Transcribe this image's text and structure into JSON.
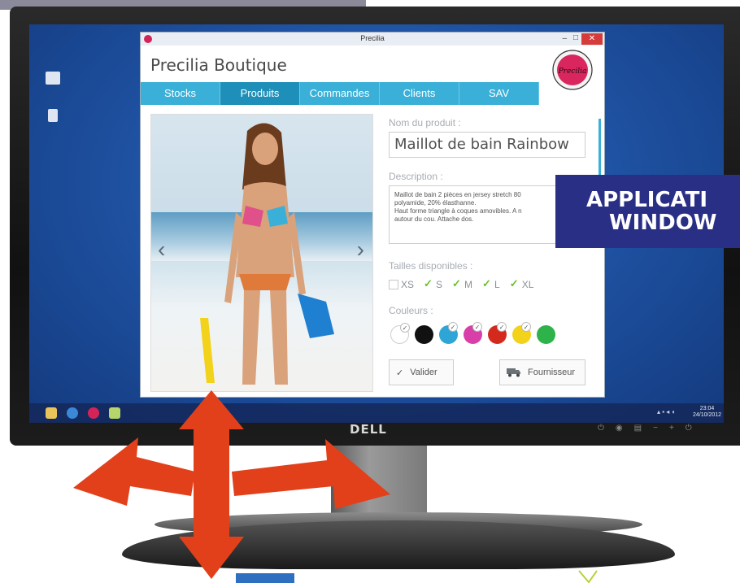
{
  "app": {
    "window_title": "Precilia",
    "app_name": "Precilia Boutique",
    "logo_text": "Precilia"
  },
  "nav": {
    "tabs": [
      {
        "label": "Stocks"
      },
      {
        "label": "Produits",
        "active": true
      },
      {
        "label": "Commandes"
      },
      {
        "label": "Clients"
      },
      {
        "label": "SAV"
      }
    ]
  },
  "product": {
    "name_label": "Nom du produit :",
    "name_value": "Maillot de bain Rainbow",
    "description_label": "Description :",
    "description_value": "Maillot de bain 2 pièces en jersey stretch 80\npolyamide, 20% élasthanne.\nHaut forme triangle à coques amovibles. A n\nautour du cou. Attache dos.",
    "sizes_label": "Tailles disponibles :",
    "sizes": [
      {
        "label": "XS",
        "checked": false
      },
      {
        "label": "S",
        "checked": true
      },
      {
        "label": "M",
        "checked": true
      },
      {
        "label": "L",
        "checked": true
      },
      {
        "label": "XL",
        "checked": true
      }
    ],
    "colors_label": "Couleurs :",
    "colors": [
      {
        "hex": "#ffffff",
        "selected": true
      },
      {
        "hex": "#111111",
        "selected": false
      },
      {
        "hex": "#2ea5d6",
        "selected": true
      },
      {
        "hex": "#d93fa8",
        "selected": true
      },
      {
        "hex": "#d42a1e",
        "selected": true
      },
      {
        "hex": "#f2d21a",
        "selected": true
      },
      {
        "hex": "#2db34a",
        "selected": false
      }
    ]
  },
  "buttons": {
    "valider": "Valider",
    "valider_icon": "✓",
    "fournisseur": "Fournisseur",
    "fournisseur_icon": "truck-icon"
  },
  "overlay": {
    "line1": "APPLICATI",
    "line2": "WINDOW"
  },
  "monitor": {
    "brand": "DELL"
  },
  "taskbar": {
    "clock_time": "23:04",
    "clock_date": "24/10/2012"
  },
  "colors": {
    "nav_tab": "#3ab0d8",
    "nav_tab_active": "#1e8fb8",
    "overlay_bg": "#2a2f86",
    "arrow_red": "#e2401a"
  }
}
